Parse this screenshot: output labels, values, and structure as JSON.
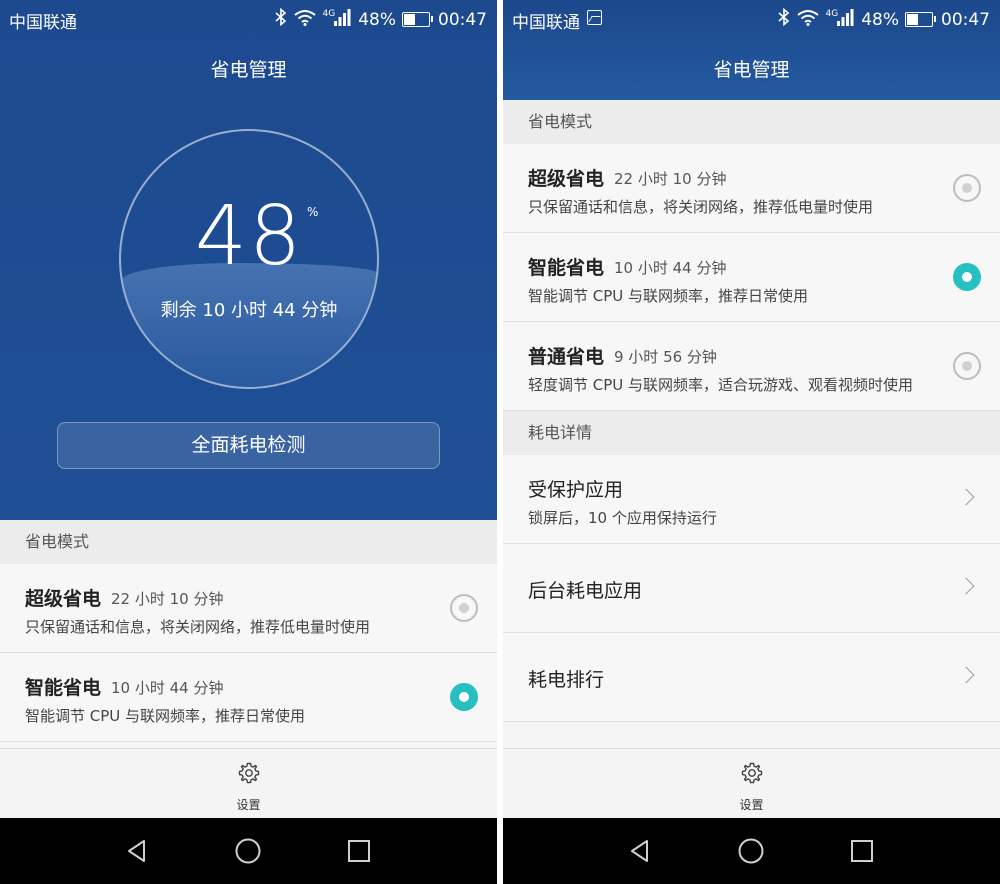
{
  "status_bar": {
    "carrier": "中国联通",
    "network": "4G",
    "battery": "48%",
    "time": "00:47"
  },
  "header": {
    "title": "省电管理"
  },
  "dial": {
    "percent": "48",
    "percent_sign": "%",
    "remaining": "剩余 10 小时 44 分钟",
    "battery_level": 0.48
  },
  "detect_button": "全面耗电检测",
  "modes_section": "省电模式",
  "modes": [
    {
      "title": "超级省电",
      "time": "22 小时 10 分钟",
      "desc": "只保留通话和信息，将关闭网络，推荐低电量时使用",
      "selected": false
    },
    {
      "title": "智能省电",
      "time": "10 小时 44 分钟",
      "desc": "智能调节 CPU 与联网频率，推荐日常使用",
      "selected": true
    },
    {
      "title": "普通省电",
      "time": "9 小时 56 分钟",
      "desc": "轻度调节 CPU 与联网频率，适合玩游戏、观看视频时使用",
      "selected": false
    }
  ],
  "details_section": "耗电详情",
  "details": [
    {
      "title": "受保护应用",
      "desc": "锁屏后，10 个应用保持运行"
    },
    {
      "title": "后台耗电应用",
      "desc": ""
    },
    {
      "title": "耗电排行",
      "desc": ""
    }
  ],
  "settings_label": "设置",
  "colors": {
    "header_blue": "#1f4f95",
    "accent_teal": "#26c0c2"
  }
}
